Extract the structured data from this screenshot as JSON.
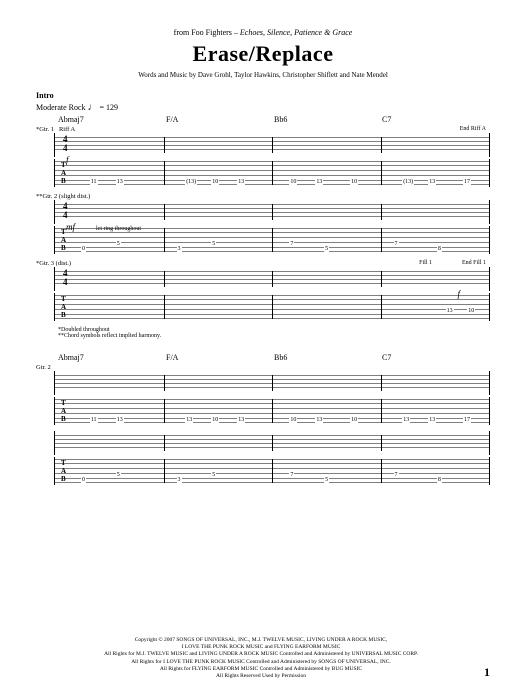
{
  "header": {
    "from_prefix": "from Foo Fighters –",
    "album": "Echoes, Silence, Patience & Grace",
    "title": "Erase/Replace",
    "credits": "Words and Music by Dave Grohl, Taylor Hawkins, Christopher Shiflett and Nate Mendel"
  },
  "section": {
    "label": "Intro",
    "tempo_text": "Moderate Rock",
    "tempo_bpm": "= 129"
  },
  "chords": {
    "row": [
      "Abmaj7",
      "F/A",
      "Bb6",
      "C7"
    ]
  },
  "guitars": {
    "g1": {
      "label": "*Gtr. 1",
      "riff": "Riff A",
      "end": "End Riff A",
      "dynamic": "f"
    },
    "g2": {
      "label": "**Gtr. 2 (slight dist.)",
      "dynamic": "mf",
      "note": "let ring throughout"
    },
    "g3": {
      "label": "*Gtr. 3 (dist.)",
      "fill": "Fill 1",
      "end": "End Fill 1",
      "dynamic": "f"
    }
  },
  "tab_letters": {
    "t": "T",
    "a": "A",
    "b": "B"
  },
  "tab_data": {
    "g1_sys1": [
      "11",
      "13",
      "(13)",
      "10",
      "13",
      "10",
      "13",
      "10",
      "(13)",
      "13",
      "17"
    ],
    "g1_sys2": [
      "11",
      "13",
      "13",
      "10",
      "13",
      "10",
      "13",
      "10",
      "13",
      "13",
      "17"
    ],
    "g2_sys1": [
      "0",
      "5",
      "3",
      "5",
      "7",
      "5",
      "7",
      "8"
    ],
    "g2_sys2": [
      "0",
      "5",
      "3",
      "5",
      "7",
      "5",
      "7",
      "8"
    ],
    "g3": [
      "13",
      "10"
    ]
  },
  "time_signature": {
    "top": "4",
    "bottom": "4"
  },
  "footnotes": {
    "a": "*Doubled throughout",
    "b": "**Chord symbols reflect implied harmony."
  },
  "system2_label": "Gtr. 2",
  "footer": {
    "l1": "Copyright © 2007 SONGS OF UNIVERSAL, INC., M.J. TWELVE MUSIC, LIVING UNDER A ROCK MUSIC,",
    "l2": "I LOVE THE PUNK ROCK MUSIC and FLYING EARFORM MUSIC",
    "l3": "All Rights for M.J. TWELVE MUSIC and LIVING UNDER A ROCK MUSIC Controlled and Administered by UNIVERSAL MUSIC CORP.",
    "l4": "All Rights for I LOVE THE PUNK ROCK MUSIC Controlled and Administered by SONGS OF UNIVERSAL, INC.",
    "l5": "All Rights for FLYING EARFORM MUSIC Controlled and Administered by BUG MUSIC",
    "l6": "All Rights Reserved   Used by Permission"
  },
  "page_number": "1"
}
